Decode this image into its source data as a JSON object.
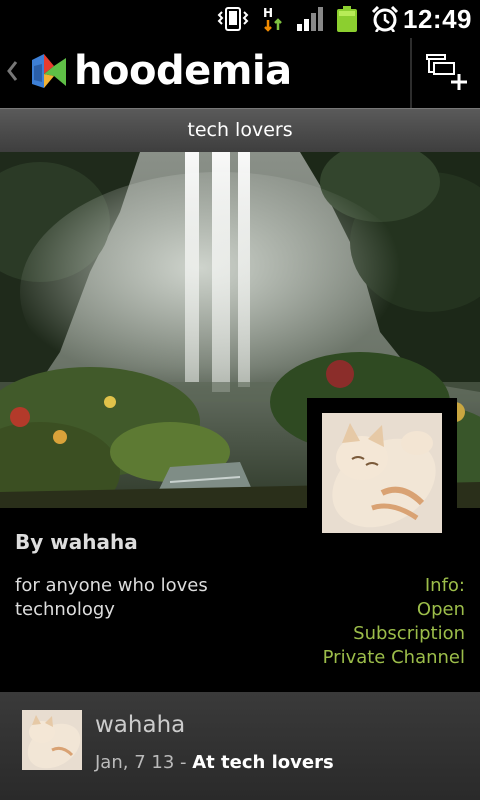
{
  "status_bar": {
    "time": "12:49",
    "network_type": "H",
    "icons": [
      "vibrate-icon",
      "network-h-icon",
      "signal-icon",
      "battery-icon",
      "alarm-icon"
    ]
  },
  "action_bar": {
    "app_name": "hoodemia",
    "icons": [
      "back-chevron-icon",
      "hoodemia-logo",
      "add-channel-icon"
    ]
  },
  "channel": {
    "title": "tech lovers",
    "owner_label": "By wahaha",
    "description": "for anyone who loves technology",
    "info": {
      "heading": "Info:",
      "lines": [
        "Open",
        "Subscription",
        "Private Channel"
      ]
    }
  },
  "posts": [
    {
      "author": "wahaha",
      "date": "Jan, 7 13 -",
      "location": "At tech lovers"
    }
  ],
  "colors": {
    "accent_green": "#9cbd4a",
    "background": "#000000",
    "title_band": "#4a4a4a"
  }
}
